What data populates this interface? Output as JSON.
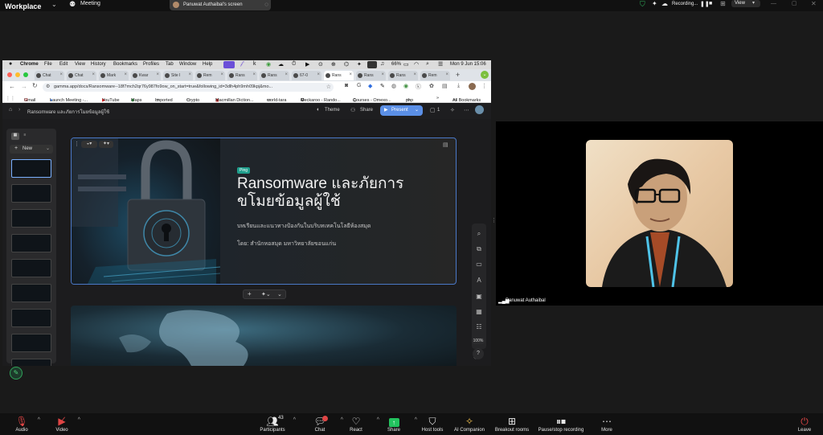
{
  "zoom": {
    "brand_lines": [
      "Workplace"
    ],
    "meeting_label": "Meeting",
    "share_banner": "Panuwat Authaibal's screen",
    "recording_label": "Recording...",
    "view_label": "View",
    "toolbar": {
      "audio": "Audio",
      "video": "Video",
      "participants": "Participants",
      "participants_count": "43",
      "chat": "Chat",
      "react": "React",
      "share": "Share",
      "host_tools": "Host tools",
      "ai_companion": "AI Companion",
      "breakout_rooms": "Breakout rooms",
      "pause_stop_recording": "Pause/stop recording",
      "more": "More",
      "leave": "Leave"
    },
    "participant_name": "Panuwat Authaibal"
  },
  "mac": {
    "menubar": [
      "Chrome",
      "File",
      "Edit",
      "View",
      "History",
      "Bookmarks",
      "Profiles",
      "Tab",
      "Window",
      "Help"
    ],
    "battery": "66%",
    "datetime": "Mon 9 Jun 15:06"
  },
  "chrome": {
    "tabs": [
      "Chat",
      "Chat",
      "Mark",
      "Kwar",
      "Site I",
      "Rem",
      "Rans",
      "Rans",
      "67-0",
      "Rans",
      "Rans",
      "Rans",
      "Rem"
    ],
    "url": "gamma.app/docs/Ransomware--18f7mch2qr76y987fo9ow_on_start=true&following_id=3dlh4ph9mh09kpj&mo...",
    "bookmarks": [
      "Gmail",
      "Launch Meeting -...",
      "YouTube",
      "Maps",
      "Imported",
      "Crypto",
      "Macmillan Diction...",
      "world-tara",
      "Meckaroo - Rando...",
      "Courses - Omexo...",
      "php"
    ],
    "all_bookmarks": "All Bookmarks"
  },
  "gamma": {
    "breadcrumb": "Ransomware และภัยการโมยข้อมูลผู้ใช้",
    "theme": "Theme",
    "share": "Share",
    "present": "Present",
    "comments": "1",
    "new_label": "New",
    "zoom_level": "100%",
    "slide": {
      "tag": "Ping",
      "title_line1": "Ransomware และภัยการ",
      "title_line2": "ขโมยข้อมูลผู้ใช้",
      "subtitle": "บทเรียนและแนวทางป้องกันในบริบทเทคโนโลยีห้องสมุด",
      "author": "โดย: สำนักหอสมุด มหาวิทยาลัยขอนแก่น"
    },
    "thumb_count": 9
  }
}
